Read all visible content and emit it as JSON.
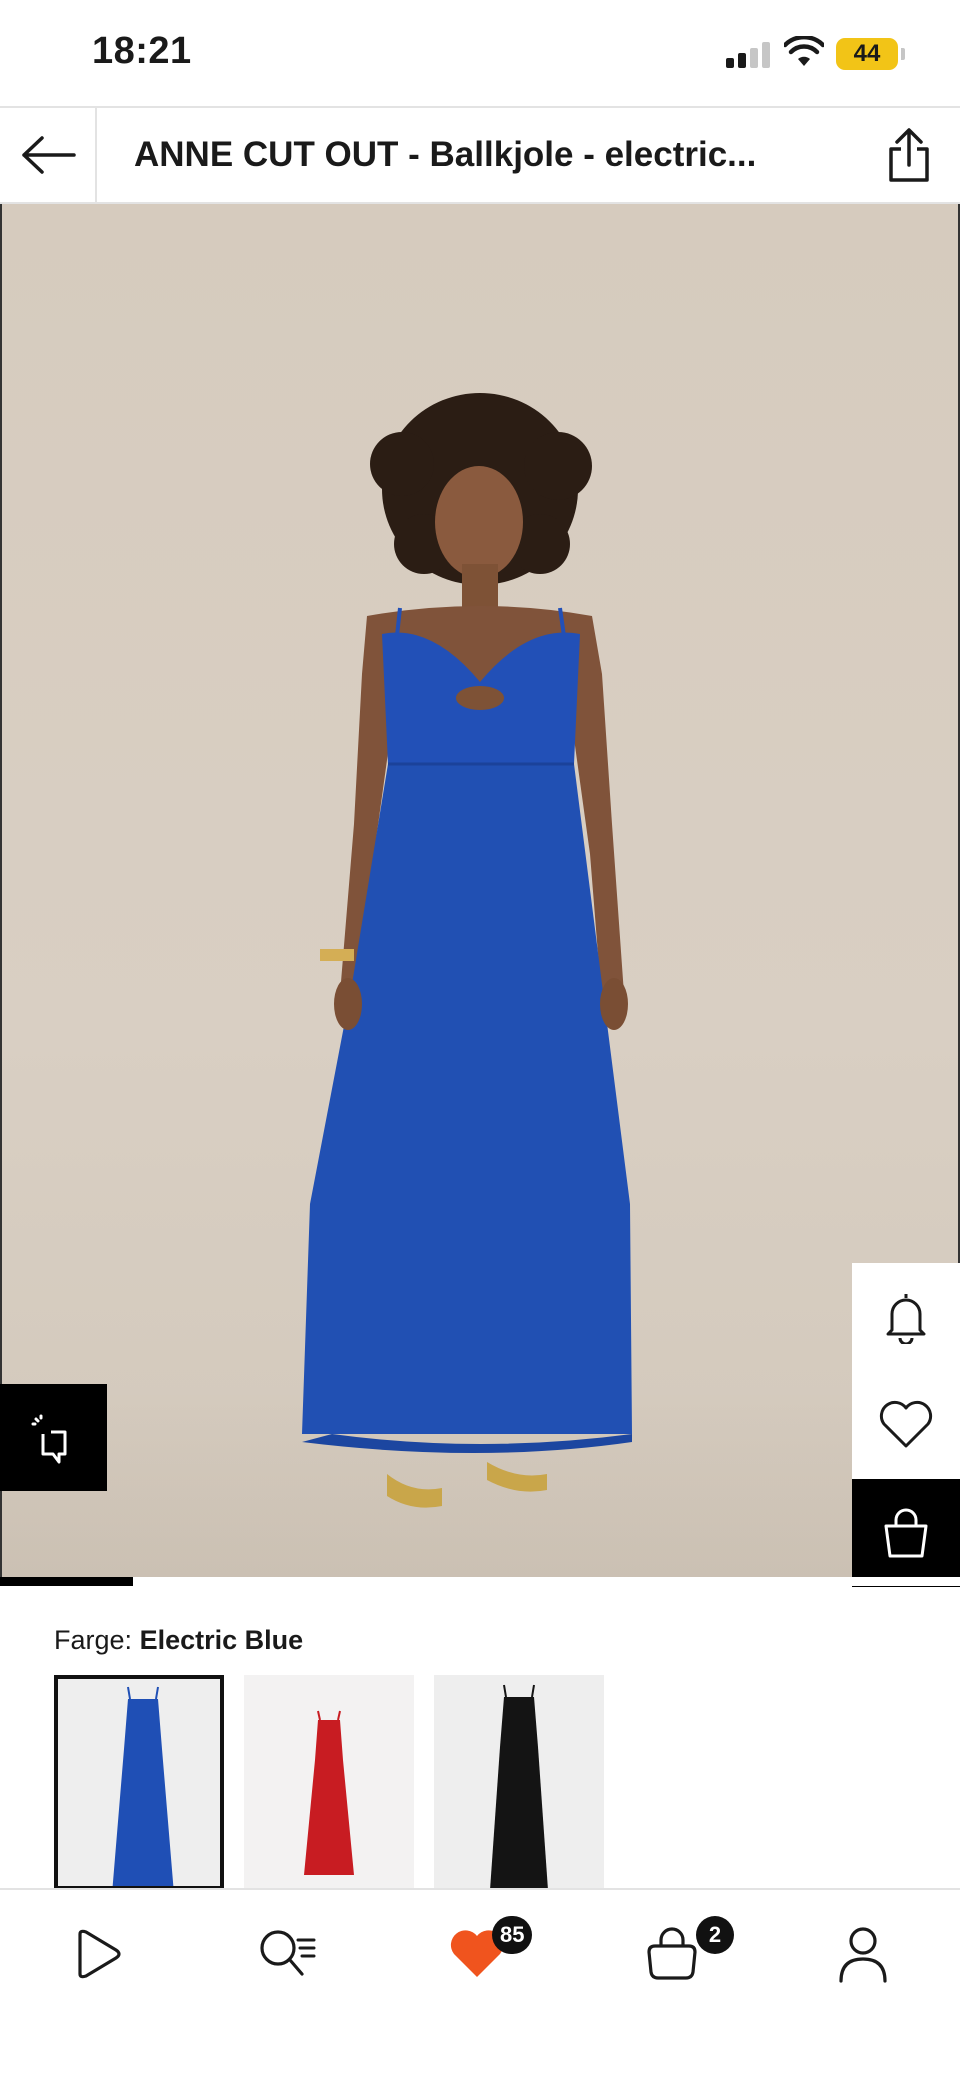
{
  "status_bar": {
    "time": "18:21",
    "battery": "44",
    "icons": [
      "signal-icon",
      "wifi-icon",
      "battery-icon"
    ]
  },
  "header": {
    "title": "ANNE CUT OUT - Ballkjole - electric...",
    "back_icon": "arrow-left-icon",
    "share_icon": "share-icon"
  },
  "product_image": {
    "slide_position": 1,
    "actions": {
      "crop_icon": "crop-view-icon",
      "bell_icon": "bell-icon",
      "heart_icon": "heart-icon",
      "bag_icon": "shopping-bag-icon"
    }
  },
  "color_picker": {
    "label_prefix": "Farge:",
    "selected": "Electric Blue",
    "options": [
      {
        "color": "#1f4fb5",
        "selected": true
      },
      {
        "color": "#c81c22",
        "selected": false
      },
      {
        "color": "#141414",
        "selected": false
      }
    ]
  },
  "bottom_nav": {
    "items": [
      {
        "icon": "play-icon"
      },
      {
        "icon": "search-list-icon"
      },
      {
        "icon": "wishlist-heart-icon",
        "badge": "85"
      },
      {
        "icon": "bag-icon",
        "badge": "2"
      },
      {
        "icon": "profile-icon"
      }
    ]
  },
  "colors": {
    "accent_heart": "#f0541e",
    "dress_blue": "#1f4fb5",
    "background": "#d7cdc1"
  }
}
